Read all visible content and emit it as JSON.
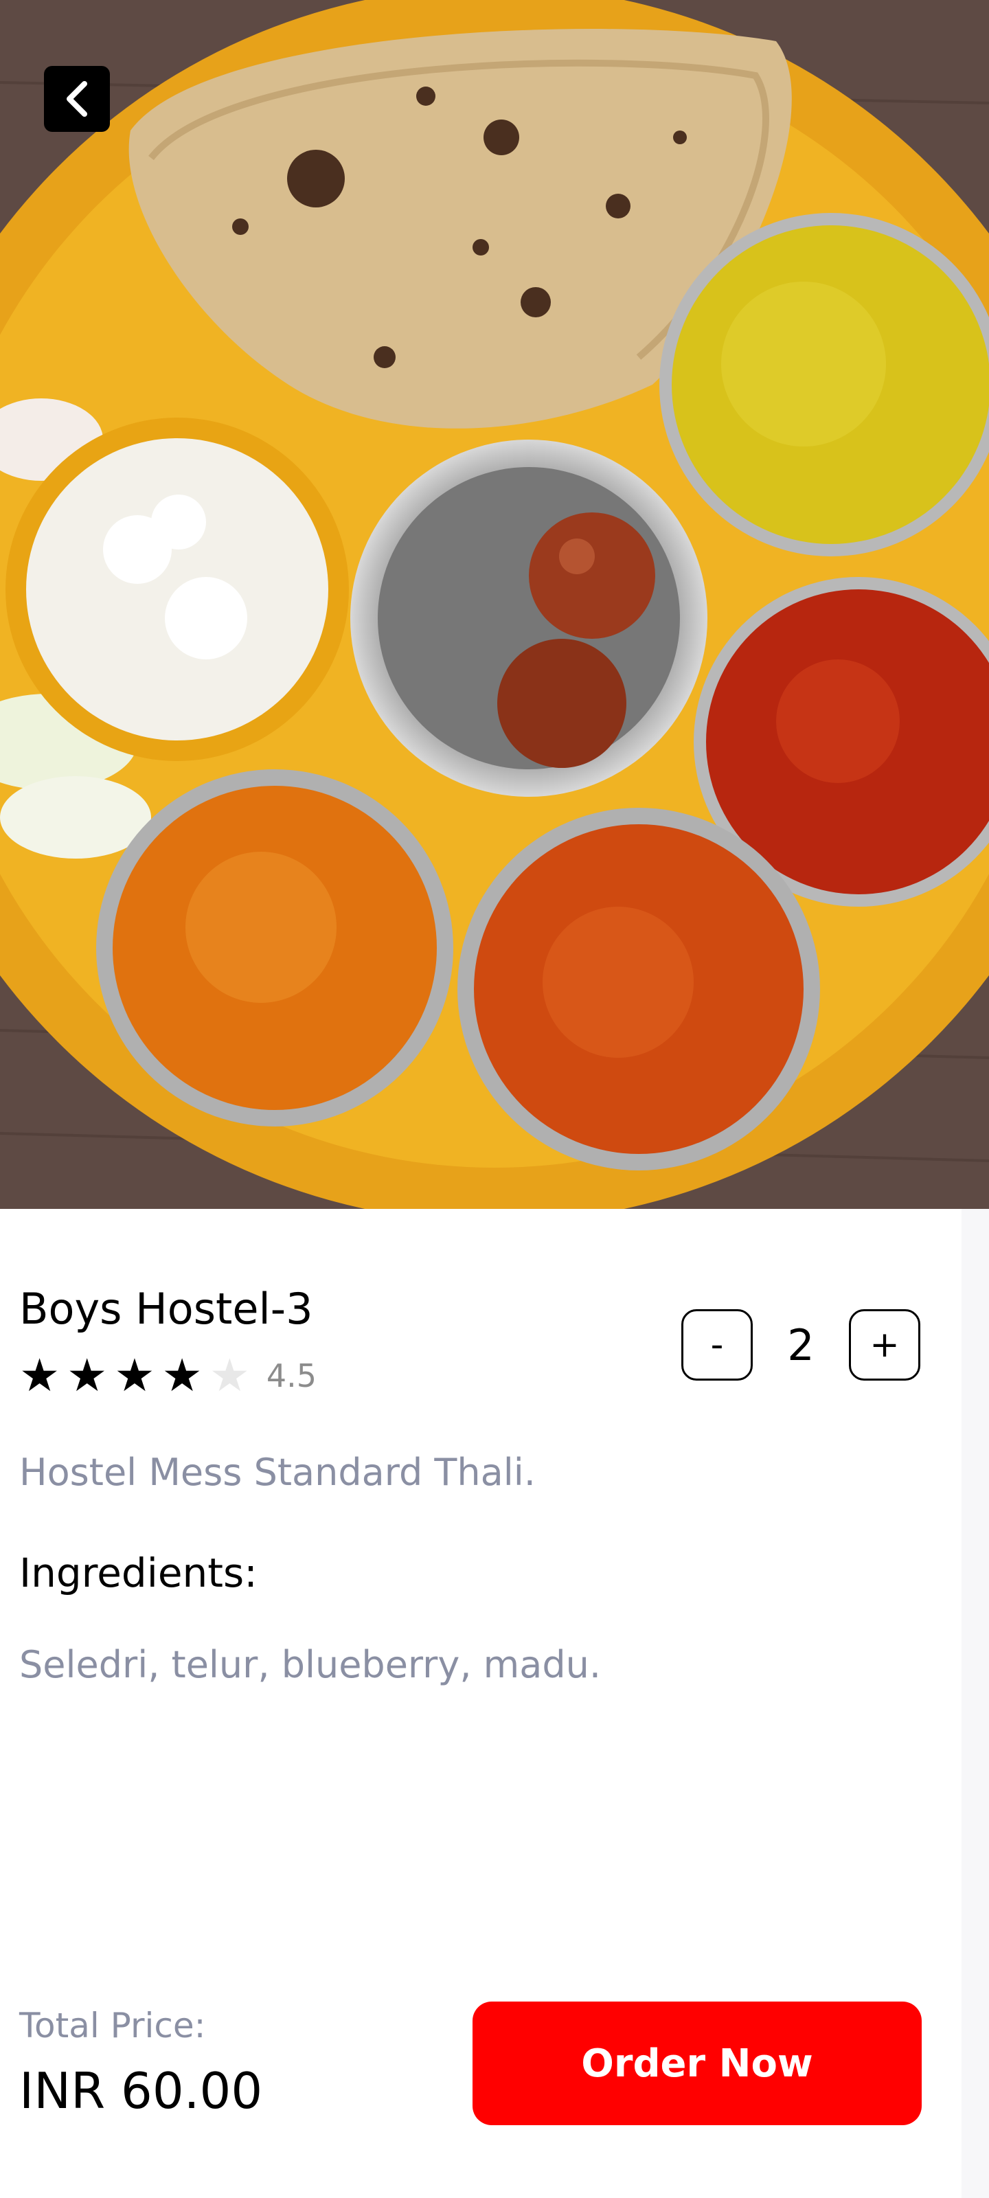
{
  "header": {
    "back_icon": "chevron-left-icon"
  },
  "item": {
    "name": "Boys Hostel-3",
    "rating": 4.5,
    "rating_label": "4.5",
    "stars_filled": 4,
    "stars_total": 5,
    "description": "Hostel Mess Standard Thali.",
    "ingredients_heading": "Ingredients:",
    "ingredients": "Seledri, telur, blueberry, madu."
  },
  "quantity": {
    "decrement_label": "-",
    "value": "2",
    "increment_label": "+"
  },
  "footer": {
    "total_label": "Total Price:",
    "total_value": "INR 60.00",
    "order_button_label": "Order Now"
  },
  "colors": {
    "accent": "#ff0000",
    "muted_text": "#8a8fa3",
    "plate": "#f0b323"
  }
}
